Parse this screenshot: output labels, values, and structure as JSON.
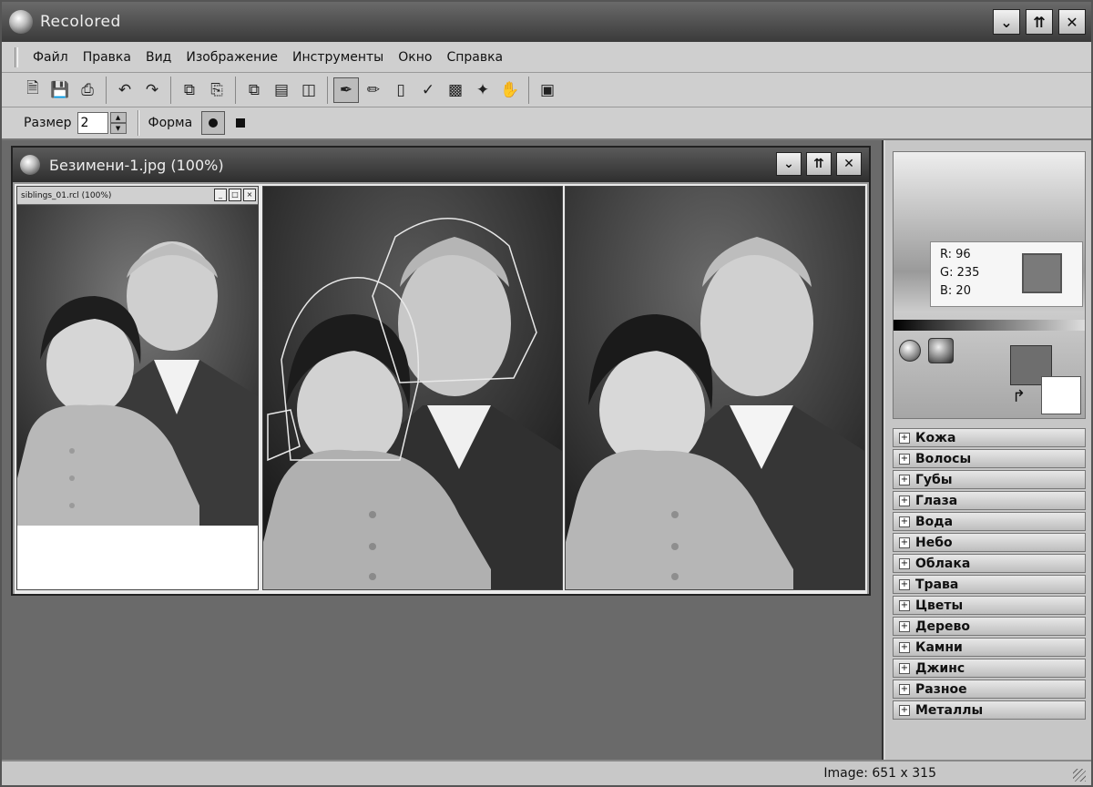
{
  "app": {
    "title": "Recolored"
  },
  "menu": [
    "Файл",
    "Правка",
    "Вид",
    "Изображение",
    "Инструменты",
    "Окно",
    "Справка"
  ],
  "options": {
    "size_label": "Размер",
    "size_value": "2",
    "shape_label": "Форма"
  },
  "child_window": {
    "title": "Безимени-1.jpg (100%)"
  },
  "mini_window": {
    "title": "siblings_01.rcl (100%)"
  },
  "color_picker": {
    "r": "R: 96",
    "g": "G: 235",
    "b": "B: 20"
  },
  "categories": [
    "Кожа",
    "Волосы",
    "Губы",
    "Глаза",
    "Вода",
    "Небо",
    "Облака",
    "Трава",
    "Цветы",
    "Дерево",
    "Камни",
    "Джинс",
    "Разное",
    "Металлы"
  ],
  "status": {
    "image_size": "Image: 651 x 315"
  },
  "icons": {
    "toolbar": [
      "new-icon",
      "save-icon",
      "print-icon",
      "undo-icon",
      "redo-icon",
      "copy-icon",
      "paste-icon",
      "layers-icon",
      "split-horizontal-icon",
      "split-vertical-icon",
      "brush-icon",
      "pencil-icon",
      "eraser-icon",
      "eyedropper-icon",
      "fill-icon",
      "magic-wand-icon",
      "hand-icon",
      "zoom-icon"
    ]
  }
}
